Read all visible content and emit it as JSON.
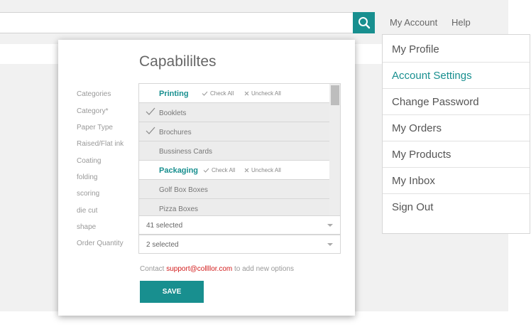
{
  "header": {
    "search_value": "",
    "account_label": "My Account",
    "help_label": "Help"
  },
  "modal": {
    "title": "Capabililtes",
    "labels": [
      "Categories",
      "Category*",
      "Paper Type",
      "Raised/Flat ink",
      "Coating",
      "folding",
      "scoring",
      "die cut",
      "shape",
      "Order Quantity"
    ],
    "groups": [
      {
        "name": "Printing",
        "check_all": "Check All",
        "uncheck_all": "Uncheck All",
        "options": [
          {
            "label": "Booklets",
            "checked": true
          },
          {
            "label": "Brochures",
            "checked": true
          },
          {
            "label": "Bussiness Cards",
            "checked": false
          }
        ]
      },
      {
        "name": "Packaging",
        "check_all": "Check All",
        "uncheck_all": "Uncheck All",
        "options": [
          {
            "label": "Golf Box Boxes",
            "checked": false
          },
          {
            "label": "Pizza Boxes",
            "checked": false
          }
        ]
      }
    ],
    "selects": [
      "41 selected",
      "2 selected"
    ],
    "contact_prefix": "Contact ",
    "contact_email": "support@collllor.com",
    "contact_suffix": " to add new options",
    "save_label": "SAVE"
  },
  "account_menu": {
    "items": [
      "My Profile",
      "Account Settings",
      "Change Password",
      "My Orders",
      "My Products",
      "My Inbox",
      "Sign Out"
    ],
    "active_index": 1
  },
  "colors": {
    "accent": "#188f8f",
    "link_red": "#d21a1a"
  }
}
